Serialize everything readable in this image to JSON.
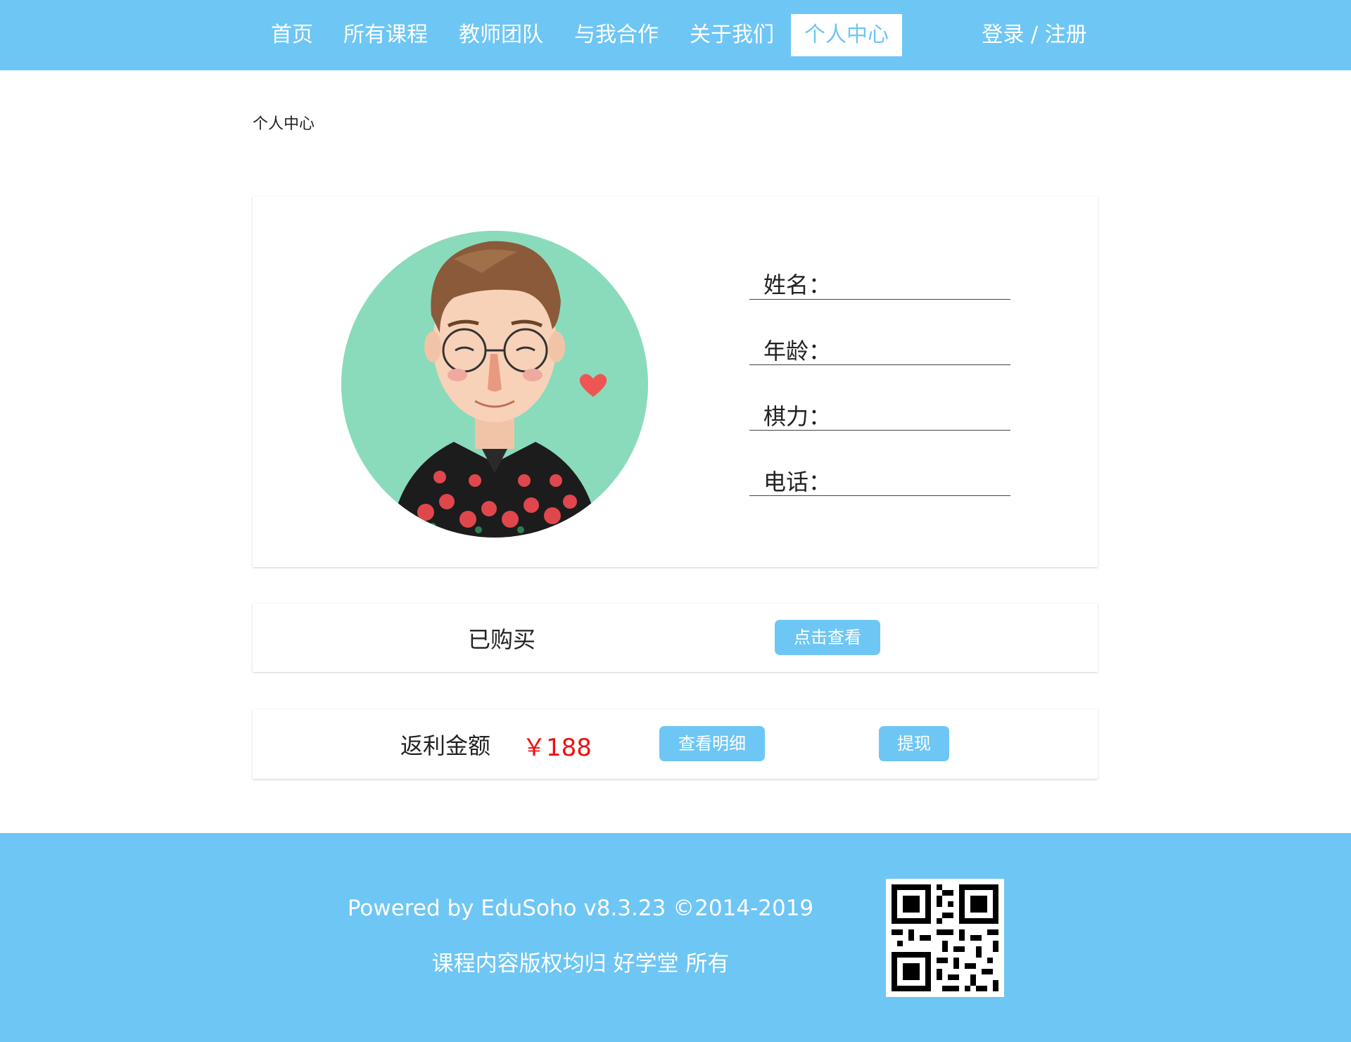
{
  "nav": {
    "items": [
      {
        "label": "首页"
      },
      {
        "label": "所有课程"
      },
      {
        "label": "教师团队"
      },
      {
        "label": "与我合作"
      },
      {
        "label": "关于我们"
      },
      {
        "label": "个人中心",
        "active": true
      }
    ],
    "auth_label": "登录 / 注册"
  },
  "breadcrumb": "个人中心",
  "profile": {
    "avatar_icon": "cartoon-avatar-icon",
    "fields": [
      {
        "label": "姓名：",
        "value": ""
      },
      {
        "label": "年龄：",
        "value": ""
      },
      {
        "label": "棋力：",
        "value": ""
      },
      {
        "label": "电话：",
        "value": ""
      }
    ]
  },
  "purchased": {
    "label": "已购买",
    "button_label": "点击查看"
  },
  "rebate": {
    "label": "返利金额",
    "amount": "￥188",
    "detail_button_label": "查看明细",
    "withdraw_button_label": "提现"
  },
  "footer": {
    "powered_by": "Powered by EduSoho v8.3.23 ©2014-2019",
    "copyright": "课程内容版权均归 好学堂 所有",
    "qr_icon": "qr-code-icon"
  },
  "colors": {
    "accent": "#6ec6f5",
    "amount": "#ee1111",
    "avatar_bg": "#8adbbb"
  }
}
